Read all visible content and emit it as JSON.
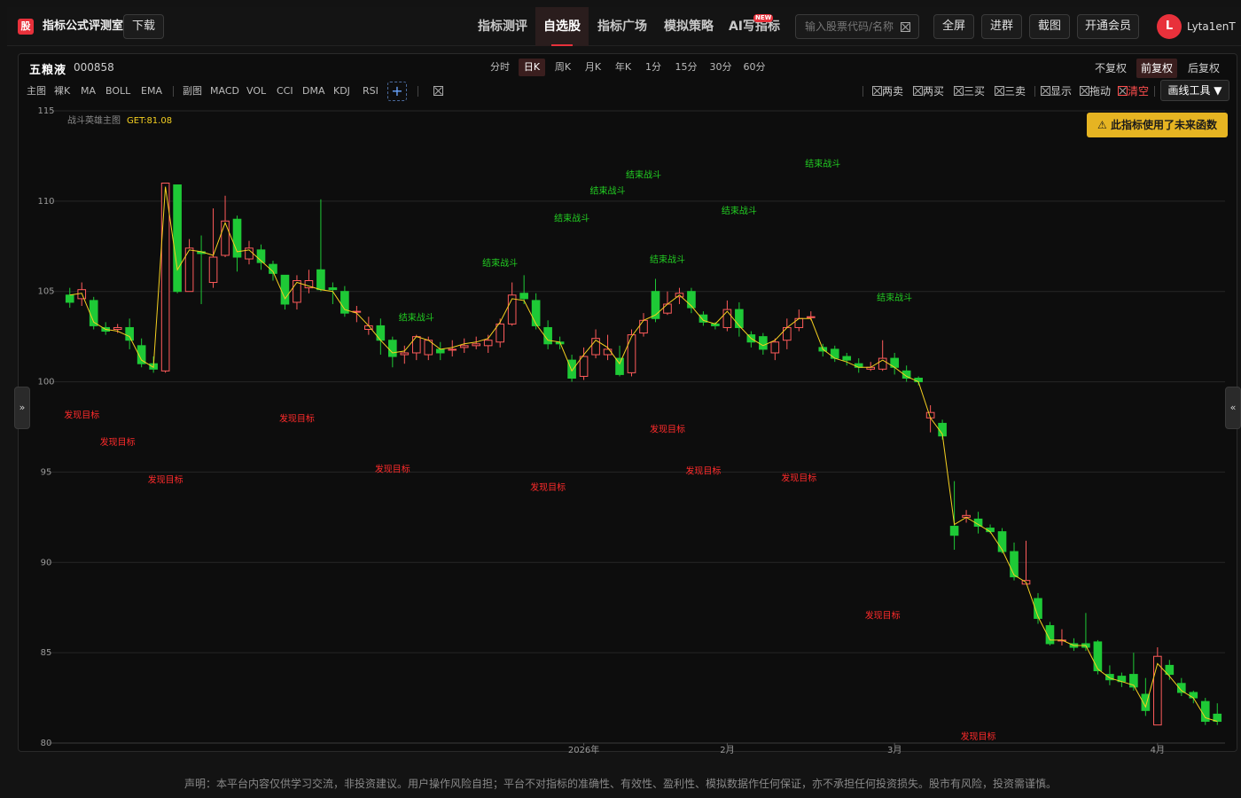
{
  "header": {
    "logo_char": "股",
    "app_title": "指标公式评测室",
    "download_label": "下载",
    "nav": [
      "指标测评",
      "自选股",
      "指标广场",
      "模拟策略",
      "AI写指标"
    ],
    "active_nav": 1,
    "new_badge": "NEW",
    "search_placeholder": "输入股票代码/名称",
    "actions": [
      "全屏",
      "进群",
      "截图",
      "开通会员"
    ],
    "avatar_letter": "L",
    "username": "Lyta1enT"
  },
  "stock": {
    "name": "五粮液",
    "code": "000858"
  },
  "periods": [
    "分时",
    "日K",
    "周K",
    "月K",
    "年K",
    "1分",
    "15分",
    "30分",
    "60分"
  ],
  "active_period": 1,
  "fuquan": [
    "不复权",
    "前复权",
    "后复权"
  ],
  "active_fuquan": 1,
  "main_indicators": [
    "主图",
    "裸K",
    "MA",
    "BOLL",
    "EMA"
  ],
  "sub_indicators": [
    "副图",
    "MACD",
    "VOL",
    "CCI",
    "DMA",
    "KDJ",
    "RSI"
  ],
  "plus_label": "+",
  "tools": [
    "两卖",
    "两买",
    "三买",
    "三卖",
    "显示",
    "拖动",
    "清空"
  ],
  "draw_tool_label": "画线工具 ▼",
  "warning": "⚠ 此指标使用了未来函数",
  "side_left": "»",
  "side_right": "«",
  "disclaimer": "声明：本平台内容仅供学习交流，非投资建议。用户操作风险自担；平台不对指标的准确性、有效性、盈利性、模拟数据作任何保证，亦不承担任何投资损失。股市有风险，投资需谨慎。",
  "colors": {
    "up": "#ff5b5b",
    "down": "#1ec936",
    "line": "#f5d020",
    "accent": "#e8313b",
    "buy_label": "#ff2b2b",
    "sell_label": "#22cc22"
  },
  "chart_data": {
    "type": "candlestick",
    "indicator_name": "战斗英雄主图",
    "indicator_value": "GET:81.08",
    "ylim": [
      80,
      115
    ],
    "yticks": [
      80,
      85,
      90,
      95,
      100,
      105,
      110,
      115
    ],
    "x_labels": [
      {
        "label": "2026年",
        "index": 43
      },
      {
        "label": "2月",
        "index": 55
      },
      {
        "label": "3月",
        "index": 69
      },
      {
        "label": "4月",
        "index": 91
      }
    ],
    "candles": [
      [
        104.8,
        104.4,
        105.2,
        104.1
      ],
      [
        104.6,
        105.1,
        105.5,
        104.2
      ],
      [
        104.5,
        103.1,
        104.7,
        102.9
      ],
      [
        103.0,
        102.8,
        103.3,
        102.6
      ],
      [
        102.9,
        103.0,
        103.2,
        102.7
      ],
      [
        103.0,
        102.3,
        103.5,
        101.8
      ],
      [
        102.0,
        101.0,
        102.4,
        100.8
      ],
      [
        101.0,
        100.7,
        101.4,
        100.5
      ],
      [
        100.6,
        111.0,
        111.0,
        100.5
      ],
      [
        110.9,
        105.0,
        110.9,
        104.9
      ],
      [
        105.0,
        107.4,
        107.9,
        105.0
      ],
      [
        107.2,
        107.1,
        108.1,
        104.3
      ],
      [
        105.5,
        106.9,
        109.6,
        105.2
      ],
      [
        107.0,
        108.9,
        110.3,
        106.9
      ],
      [
        109.0,
        106.9,
        109.2,
        106.1
      ],
      [
        106.8,
        107.4,
        107.8,
        106.5
      ],
      [
        107.3,
        106.6,
        107.6,
        106.2
      ],
      [
        106.5,
        106.0,
        106.7,
        105.6
      ],
      [
        105.9,
        104.3,
        105.8,
        104.0
      ],
      [
        104.4,
        105.6,
        105.9,
        104.0
      ],
      [
        105.2,
        105.6,
        106.2,
        104.9
      ],
      [
        106.2,
        105.1,
        110.1,
        105.0
      ],
      [
        105.2,
        105.1,
        105.5,
        104.3
      ],
      [
        105.0,
        103.8,
        105.3,
        103.6
      ],
      [
        103.9,
        103.9,
        104.2,
        103.3
      ],
      [
        102.9,
        103.1,
        103.6,
        102.6
      ],
      [
        103.1,
        102.3,
        103.5,
        101.5
      ],
      [
        102.3,
        101.4,
        102.5,
        100.8
      ],
      [
        101.5,
        101.6,
        102.0,
        101.0
      ],
      [
        101.6,
        102.5,
        102.6,
        101.2
      ],
      [
        101.5,
        102.3,
        102.5,
        101.2
      ],
      [
        101.8,
        101.6,
        102.2,
        101.2
      ],
      [
        101.8,
        101.8,
        102.3,
        101.4
      ],
      [
        101.9,
        102.0,
        102.4,
        101.6
      ],
      [
        102.0,
        102.1,
        102.5,
        101.8
      ],
      [
        102.0,
        102.3,
        102.6,
        101.6
      ],
      [
        102.2,
        103.2,
        103.5,
        101.9
      ],
      [
        103.2,
        104.8,
        105.5,
        103.1
      ],
      [
        104.9,
        104.6,
        105.9,
        104.3
      ],
      [
        104.5,
        103.1,
        104.9,
        102.9
      ],
      [
        103.0,
        102.1,
        103.4,
        101.8
      ],
      [
        102.2,
        102.1,
        102.5,
        101.8
      ],
      [
        101.2,
        100.2,
        101.5,
        100.0
      ],
      [
        100.3,
        101.4,
        101.9,
        100.1
      ],
      [
        101.5,
        102.4,
        102.9,
        101.3
      ],
      [
        101.5,
        101.8,
        102.6,
        101.2
      ],
      [
        101.3,
        100.4,
        102.0,
        100.3
      ],
      [
        100.5,
        102.6,
        102.9,
        100.3
      ],
      [
        102.7,
        103.4,
        103.8,
        102.5
      ],
      [
        105.0,
        103.5,
        105.7,
        103.3
      ],
      [
        103.8,
        104.3,
        105.0,
        103.7
      ],
      [
        104.7,
        104.9,
        105.2,
        104.3
      ],
      [
        105.0,
        104.1,
        105.2,
        103.8
      ],
      [
        103.7,
        103.3,
        103.9,
        103.1
      ],
      [
        103.2,
        103.1,
        103.3,
        102.9
      ],
      [
        103.0,
        104.0,
        104.5,
        102.8
      ],
      [
        104.0,
        103.0,
        104.4,
        102.5
      ],
      [
        102.6,
        102.2,
        102.8,
        101.9
      ],
      [
        102.5,
        101.8,
        102.7,
        101.5
      ],
      [
        101.6,
        102.2,
        102.4,
        101.2
      ],
      [
        102.3,
        103.0,
        103.5,
        101.8
      ],
      [
        103.0,
        103.5,
        104.0,
        102.8
      ],
      [
        103.6,
        103.6,
        103.9,
        103.4
      ],
      [
        101.9,
        101.7,
        102.1,
        101.4
      ],
      [
        101.8,
        101.3,
        102.0,
        101.1
      ],
      [
        101.4,
        101.2,
        101.6,
        100.9
      ],
      [
        101.0,
        100.8,
        101.3,
        100.5
      ],
      [
        100.7,
        100.8,
        101.1,
        100.6
      ],
      [
        100.7,
        101.3,
        102.3,
        100.6
      ],
      [
        101.3,
        100.8,
        101.6,
        100.4
      ],
      [
        100.6,
        100.2,
        100.9,
        100.0
      ],
      [
        100.2,
        100.0,
        100.3,
        99.8
      ],
      [
        98.0,
        98.3,
        98.7,
        97.2
      ],
      [
        97.7,
        97.0,
        97.9,
        96.8
      ],
      [
        92.0,
        91.5,
        94.5,
        90.7
      ],
      [
        92.5,
        92.6,
        92.9,
        92.2
      ],
      [
        92.4,
        92.0,
        92.8,
        91.6
      ],
      [
        91.9,
        91.7,
        92.1,
        91.6
      ],
      [
        91.7,
        90.6,
        91.9,
        90.5
      ],
      [
        90.6,
        89.2,
        91.1,
        89.0
      ],
      [
        88.8,
        89.0,
        91.2,
        88.8
      ],
      [
        88.0,
        86.9,
        88.3,
        86.6
      ],
      [
        86.5,
        85.5,
        86.7,
        85.4
      ],
      [
        85.7,
        85.7,
        86.3,
        85.4
      ],
      [
        85.5,
        85.3,
        85.8,
        85.1
      ],
      [
        85.5,
        85.3,
        87.2,
        85.1
      ],
      [
        85.6,
        84.0,
        85.7,
        83.8
      ],
      [
        83.8,
        83.5,
        84.3,
        83.2
      ],
      [
        83.7,
        83.4,
        83.9,
        83.1
      ],
      [
        83.8,
        83.1,
        85.0,
        82.9
      ],
      [
        82.7,
        81.8,
        83.6,
        81.5
      ],
      [
        81.0,
        84.8,
        85.3,
        81.0
      ],
      [
        84.3,
        83.8,
        84.6,
        83.5
      ],
      [
        83.3,
        82.8,
        83.6,
        82.6
      ],
      [
        82.8,
        82.5,
        82.9,
        82.2
      ],
      [
        82.3,
        81.2,
        82.5,
        81.0
      ],
      [
        81.6,
        81.2,
        82.2,
        81.0
      ]
    ],
    "line": [
      104.8,
      104.9,
      103.3,
      102.9,
      102.8,
      102.5,
      101.2,
      100.8,
      110.8,
      106.2,
      107.3,
      107.2,
      107.0,
      108.8,
      107.2,
      107.3,
      106.7,
      106.1,
      104.6,
      105.5,
      105.3,
      105.1,
      105.0,
      104.0,
      103.8,
      103.1,
      102.3,
      101.6,
      101.7,
      102.5,
      102.3,
      101.8,
      101.9,
      102.1,
      102.2,
      102.4,
      103.3,
      104.6,
      104.5,
      103.2,
      102.3,
      102.2,
      100.6,
      101.5,
      102.3,
      101.9,
      101.0,
      102.5,
      103.4,
      103.7,
      104.3,
      104.8,
      104.2,
      103.4,
      103.2,
      103.9,
      103.1,
      102.4,
      102.0,
      102.3,
      103.0,
      103.5,
      103.5,
      101.8,
      101.3,
      101.1,
      100.8,
      100.8,
      101.2,
      100.8,
      100.3,
      100.0,
      98.0,
      97.1,
      92.1,
      92.5,
      92.1,
      91.7,
      90.7,
      89.3,
      88.9,
      87.0,
      85.7,
      85.7,
      85.4,
      85.4,
      84.1,
      83.6,
      83.4,
      83.2,
      82.0,
      84.4,
      83.7,
      82.9,
      82.5,
      81.4,
      81.2
    ],
    "sell_labels": [
      {
        "text": "结束战斗",
        "index": 29,
        "value": 103.4
      },
      {
        "text": "结束战斗",
        "index": 36,
        "value": 106.4
      },
      {
        "text": "结束战斗",
        "index": 42,
        "value": 108.9
      },
      {
        "text": "结束战斗",
        "index": 45,
        "value": 110.4
      },
      {
        "text": "结束战斗",
        "index": 48,
        "value": 111.3
      },
      {
        "text": "结束战斗",
        "index": 50,
        "value": 106.6
      },
      {
        "text": "结束战斗",
        "index": 56,
        "value": 109.3
      },
      {
        "text": "结束战斗",
        "index": 63,
        "value": 111.9
      },
      {
        "text": "结束战斗",
        "index": 69,
        "value": 104.5
      }
    ],
    "buy_labels": [
      {
        "text": "发现目标",
        "index": 1,
        "value": 98.0
      },
      {
        "text": "发现目标",
        "index": 4,
        "value": 96.5
      },
      {
        "text": "发现目标",
        "index": 8,
        "value": 94.4
      },
      {
        "text": "发现目标",
        "index": 19,
        "value": 97.8
      },
      {
        "text": "发现目标",
        "index": 27,
        "value": 95.0
      },
      {
        "text": "发现目标",
        "index": 40,
        "value": 94.0
      },
      {
        "text": "发现目标",
        "index": 50,
        "value": 97.2
      },
      {
        "text": "发现目标",
        "index": 53,
        "value": 94.9
      },
      {
        "text": "发现目标",
        "index": 61,
        "value": 94.5
      },
      {
        "text": "发现目标",
        "index": 68,
        "value": 86.9
      },
      {
        "text": "发现目标",
        "index": 76,
        "value": 80.2
      }
    ]
  }
}
